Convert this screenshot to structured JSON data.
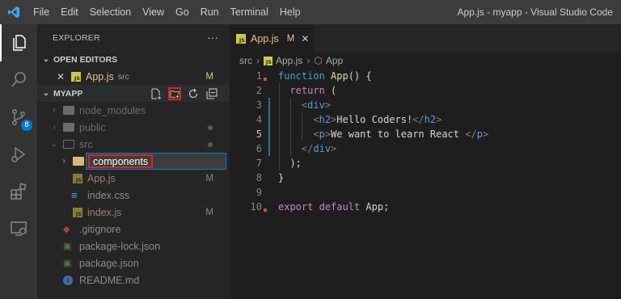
{
  "menu": [
    "File",
    "Edit",
    "Selection",
    "View",
    "Go",
    "Run",
    "Terminal",
    "Help"
  ],
  "window_title": "App.js - myapp - Visual Studio Code",
  "activity": {
    "scm_badge": "8"
  },
  "explorer": {
    "title": "EXPLORER",
    "more": "···",
    "open_editors_label": "OPEN EDITORS",
    "open_file": {
      "name": "App.js",
      "folder": "src",
      "status": "M"
    },
    "project_label": "MYAPP",
    "tree": [
      {
        "name": "node_modules",
        "kind": "folder",
        "status": ""
      },
      {
        "name": "public",
        "kind": "folder",
        "status": "dot"
      },
      {
        "name": "src",
        "kind": "folder-open",
        "status": "dot"
      },
      {
        "name": "components",
        "kind": "rename-input",
        "status": ""
      },
      {
        "name": "App.js",
        "kind": "js",
        "status": "M"
      },
      {
        "name": "index.css",
        "kind": "css",
        "status": ""
      },
      {
        "name": "index.js",
        "kind": "js",
        "status": "M"
      },
      {
        "name": ".gitignore",
        "kind": "git",
        "status": ""
      },
      {
        "name": "package-lock.json",
        "kind": "json",
        "status": ""
      },
      {
        "name": "package.json",
        "kind": "json",
        "status": ""
      },
      {
        "name": "README.md",
        "kind": "info",
        "status": ""
      }
    ]
  },
  "tab": {
    "name": "App.js",
    "status": "M",
    "close": "✕"
  },
  "breadcrumb": {
    "folder": "src",
    "file": "App.js",
    "symbol": "App"
  },
  "code_lines": [
    "1",
    "2",
    "3",
    "4",
    "5",
    "6",
    "7",
    "8",
    "9",
    "10"
  ],
  "code": {
    "l1_kw": "function",
    "l1_fn": "App",
    "l1_rest": "() {",
    "l2_kw": "return",
    "l2_rest": " (",
    "l3_open": "<",
    "l3_tag": "div",
    "l3_close": ">",
    "l4_open": "<",
    "l4_tag": "h2",
    "l4_close": ">",
    "l4_text": "Hello Coders!",
    "l4_end_open": "</",
    "l4_end_tag": "h2",
    "l4_end_close": ">",
    "l5_open": "<",
    "l5_tag": "p",
    "l5_close": ">",
    "l5_text": "We want to learn React ",
    "l5_end_open": "</",
    "l5_end_tag": "p",
    "l5_end_close": ">",
    "l6_open": "</",
    "l6_tag": "div",
    "l6_close": ">",
    "l7": ");",
    "l8": "}",
    "l10_kw": "export",
    "l10_kw2": "default",
    "l10_rest": " App;"
  }
}
